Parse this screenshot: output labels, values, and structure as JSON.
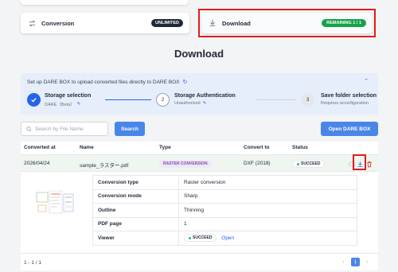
{
  "tabs": {
    "conversion": {
      "label": "Conversion",
      "badge": "UNLIMITED"
    },
    "download": {
      "label": "Download",
      "badge": "REMAINING 1 / 1"
    }
  },
  "page": {
    "title": "Download"
  },
  "setup": {
    "text": "Set up DARE BOX to upload converted files directly to DARE BOX",
    "steps": [
      {
        "number": "",
        "title": "Storage selection",
        "subtitle": "DARE（Beta）"
      },
      {
        "number": "2",
        "title": "Storage Authentication",
        "subtitle": "Unauthorized"
      },
      {
        "number": "3",
        "title": "Save folder selection",
        "subtitle": "Requires reconfiguration"
      }
    ]
  },
  "search": {
    "placeholder": "Search by File Name",
    "button": "Search"
  },
  "open_button": "Open DARE BOX",
  "table": {
    "headers": [
      "Converted at",
      "Name",
      "Type",
      "Convert to",
      "Status"
    ],
    "row": {
      "converted_at": "2026/04/24",
      "name": "sample_ラスター.pdf",
      "type": "RASTER CONVERSION",
      "convert_to": "DXF (2018)",
      "status": "SUCCEED"
    }
  },
  "details": {
    "rows": [
      {
        "key": "Conversion type",
        "value": "Raster conversion"
      },
      {
        "key": "Conversion mode",
        "value": "Sharp"
      },
      {
        "key": "Outline",
        "value": "Thinning"
      },
      {
        "key": "PDF page",
        "value": "1"
      }
    ],
    "viewer": {
      "key": "Viewer",
      "status": "SUCCEED",
      "link": "Open"
    }
  },
  "pagination": {
    "count": "1 - 1 / 1",
    "current": "1",
    "prev": "‹",
    "next": "›"
  },
  "colors": {
    "accent": "#4a86e8",
    "success": "#16a34a",
    "highlight": "#e11d1d"
  }
}
